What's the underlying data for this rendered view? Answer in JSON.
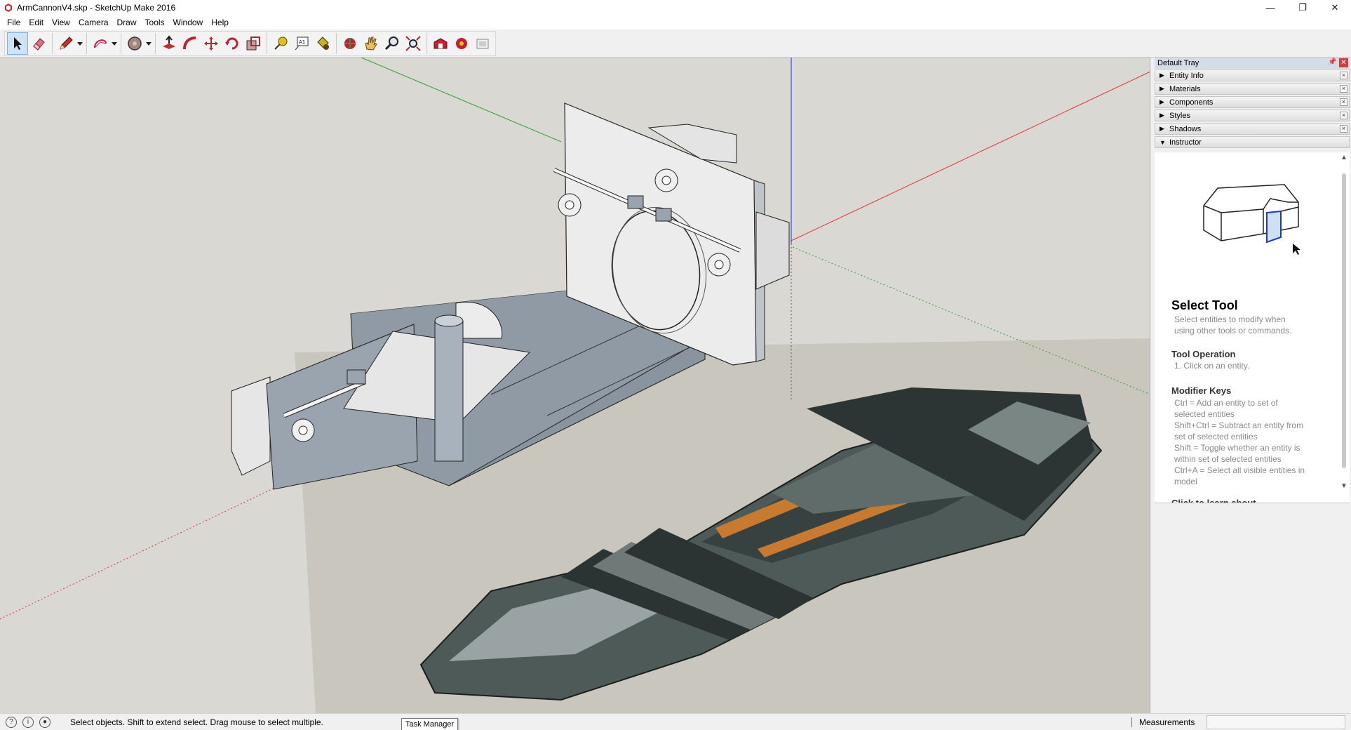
{
  "window": {
    "title": "ArmCannonV4.skp - SketchUp Make 2016",
    "minimize": "—",
    "restore": "❐",
    "close": "✕"
  },
  "menu": [
    "File",
    "Edit",
    "View",
    "Camera",
    "Draw",
    "Tools",
    "Window",
    "Help"
  ],
  "toolbar": {
    "tools": [
      {
        "name": "select-tool",
        "icon": "arrow-icon",
        "active": true
      },
      {
        "name": "eraser-tool",
        "icon": "eraser-icon"
      },
      {
        "name": "line-tool",
        "icon": "pencil-icon",
        "dropdown": true
      },
      {
        "name": "arc-tool",
        "icon": "arc-icon",
        "dropdown": true
      },
      {
        "name": "shapes-tool",
        "icon": "circle-icon",
        "dropdown": true
      },
      {
        "name": "push-pull-tool",
        "icon": "push-pull-icon"
      },
      {
        "name": "follow-me-tool",
        "icon": "follow-me-icon"
      },
      {
        "name": "move-tool",
        "icon": "move-icon"
      },
      {
        "name": "rotate-tool",
        "icon": "rotate-icon"
      },
      {
        "name": "scale-tool",
        "icon": "scale-icon"
      },
      {
        "name": "tape-measure-tool",
        "icon": "tape-icon"
      },
      {
        "name": "text-tool",
        "icon": "text-icon"
      },
      {
        "name": "paint-bucket-tool",
        "icon": "paint-icon"
      },
      {
        "name": "orbit-tool",
        "icon": "orbit-icon"
      },
      {
        "name": "pan-tool",
        "icon": "hand-icon"
      },
      {
        "name": "zoom-tool",
        "icon": "zoom-icon"
      },
      {
        "name": "zoom-extents-tool",
        "icon": "zoom-extents-icon"
      },
      {
        "name": "warehouse-tool",
        "icon": "warehouse-icon"
      },
      {
        "name": "extension-warehouse-tool",
        "icon": "extension-icon"
      },
      {
        "name": "layout-tool",
        "icon": "layout-icon"
      }
    ]
  },
  "tray": {
    "title": "Default Tray",
    "panels": [
      {
        "label": "Entity Info",
        "expanded": false
      },
      {
        "label": "Materials",
        "expanded": false
      },
      {
        "label": "Components",
        "expanded": false
      },
      {
        "label": "Styles",
        "expanded": false
      },
      {
        "label": "Shadows",
        "expanded": false
      },
      {
        "label": "Instructor",
        "expanded": true
      }
    ],
    "instructor": {
      "title": "Select Tool",
      "desc1": "Select entities to modify when",
      "desc2": "using other tools or commands.",
      "op_head": "Tool Operation",
      "op1": "1.   Click on an entity.",
      "mod_head": "Modifier Keys",
      "mods": [
        "Ctrl = Add an entity to set of",
        "selected entities",
        "Shift+Ctrl = Subtract an entity from",
        "set of selected entities",
        "Shift = Toggle whether an entity is",
        "within set of selected entities",
        "Ctrl+A = Select all visible entities in",
        "model"
      ],
      "cut_head": "Click to learn about"
    }
  },
  "status": {
    "text": "Select objects. Shift to extend select. Drag mouse to select multiple.",
    "tooltip": "Task Manager",
    "measurements_label": "Measurements",
    "measurements_value": ""
  },
  "colors": {
    "viewport_bg": "#d9d8d2",
    "ground": "#c9c7bd",
    "axis_red": "#e03030",
    "axis_green": "#30a030",
    "axis_blue": "#2030e0"
  }
}
